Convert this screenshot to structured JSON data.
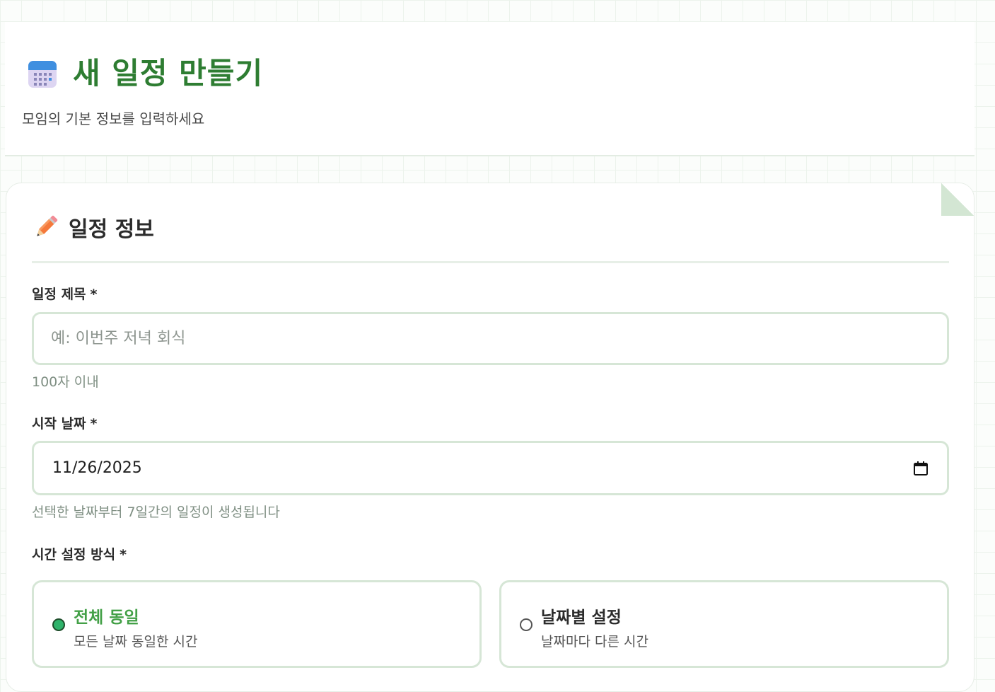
{
  "header": {
    "title": "새 일정 만들기",
    "subtitle": "모임의 기본 정보를 입력하세요",
    "icon": "calendar-icon"
  },
  "section": {
    "title": "일정 정보",
    "icon": "pencil-icon"
  },
  "fields": {
    "title": {
      "label": "일정 제목",
      "required": "*",
      "placeholder": "예: 이번주 저녁 회식",
      "value": "",
      "help": "100자 이내"
    },
    "start_date": {
      "label": "시작 날짜",
      "required": "*",
      "value": "11/26/2025",
      "help": "선택한 날짜부터 7일간의 일정이 생성됩니다",
      "icon": "calendar-picker-icon"
    },
    "time_mode": {
      "label": "시간 설정 방식",
      "required": "*",
      "options": [
        {
          "title": "전체 동일",
          "desc": "모든 날짜 동일한 시간",
          "selected": true
        },
        {
          "title": "날짜별 설정",
          "desc": "날짜마다 다른 시간",
          "selected": false
        }
      ]
    }
  },
  "colors": {
    "accent": "#2e7d32",
    "selected_option_text": "#43a047",
    "input_border": "#d6e6d6"
  }
}
